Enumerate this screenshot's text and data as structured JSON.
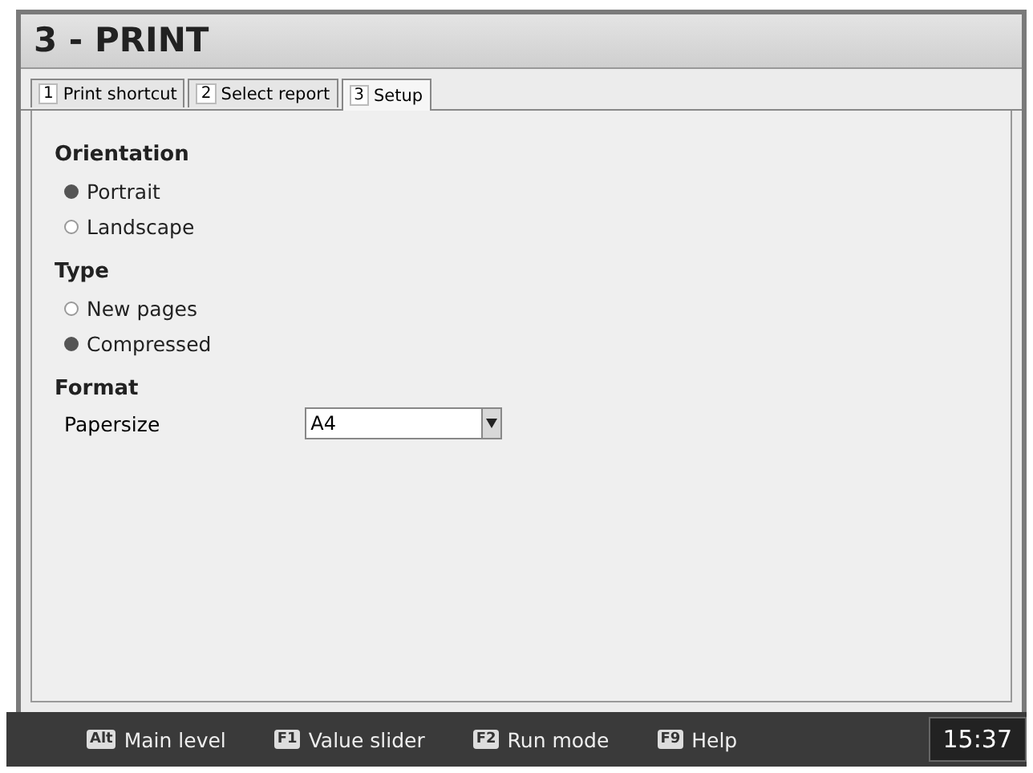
{
  "window": {
    "title": "3 - PRINT"
  },
  "tabs": [
    {
      "key": "1",
      "label": "Print shortcut",
      "selected": false
    },
    {
      "key": "2",
      "label": "Select report",
      "selected": false
    },
    {
      "key": "3",
      "label": "Setup",
      "selected": true
    }
  ],
  "groups": [
    {
      "title": "Orientation",
      "options": [
        {
          "label": "Portrait",
          "selected": true
        },
        {
          "label": "Landscape",
          "selected": false
        }
      ]
    },
    {
      "title": "Type",
      "options": [
        {
          "label": "New pages",
          "selected": false
        },
        {
          "label": "Compressed",
          "selected": true
        }
      ]
    }
  ],
  "format": {
    "title": "Format",
    "label": "Papersize",
    "value": "A4"
  },
  "status_bar": {
    "hints": [
      {
        "key": "Alt",
        "label": "Main level"
      },
      {
        "key": "F1",
        "label": "Value slider"
      },
      {
        "key": "F2",
        "label": "Run mode"
      },
      {
        "key": "F9",
        "label": "Help"
      }
    ],
    "time": "15:37"
  }
}
